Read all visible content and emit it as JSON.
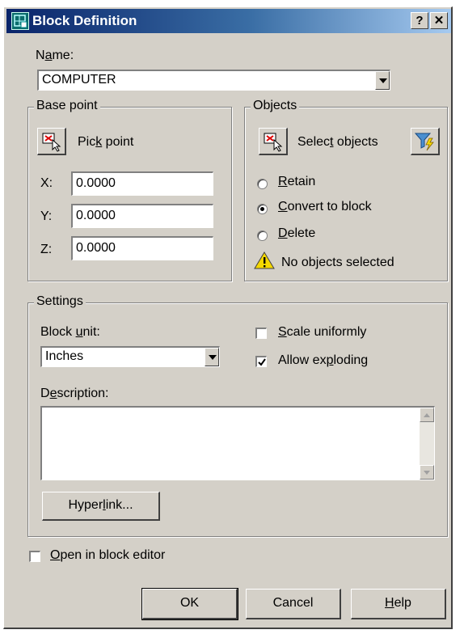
{
  "window": {
    "title": "Block Definition",
    "help_btn": "?",
    "close_btn": "✕"
  },
  "name": {
    "label_pre": "N",
    "label_u": "a",
    "label_post": "me:",
    "value": "COMPUTER"
  },
  "base_point": {
    "title": "Base point",
    "pick_label_pre": "Pic",
    "pick_label_u": "k",
    "pick_label_post": " point",
    "x_label": "X:",
    "x_value": "0.0000",
    "y_label": "Y:",
    "y_value": "0.0000",
    "z_label": "Z:",
    "z_value": "0.0000"
  },
  "objects": {
    "title": "Objects",
    "select_pre": "Selec",
    "select_u": "t",
    "select_post": " objects",
    "retain_u": "R",
    "retain_post": "etain",
    "convert_u": "C",
    "convert_post": "onvert to block",
    "delete_u": "D",
    "delete_post": "elete",
    "selected_option": "convert",
    "warning": "No objects selected"
  },
  "settings": {
    "title": "Settings",
    "unit_label_pre": "Block ",
    "unit_label_u": "u",
    "unit_label_post": "nit:",
    "unit_value": "Inches",
    "scale_u": "S",
    "scale_post": "cale uniformly",
    "scale_checked": false,
    "explode_pre": "Allow ex",
    "explode_u": "p",
    "explode_post": "loding",
    "explode_checked": true,
    "desc_pre": "D",
    "desc_u": "e",
    "desc_post": "scription:",
    "hyperlink_pre": "Hyper",
    "hyperlink_u": "l",
    "hyperlink_post": "ink..."
  },
  "open_editor": {
    "u": "O",
    "post": "pen in block editor",
    "checked": false
  },
  "buttons": {
    "ok": "OK",
    "cancel": "Cancel",
    "help_u": "H",
    "help_post": "elp"
  },
  "colors": {
    "title_start": "#0a246a",
    "title_end": "#a6caf0",
    "face": "#d4d0c8",
    "warning": "#f5d800"
  }
}
